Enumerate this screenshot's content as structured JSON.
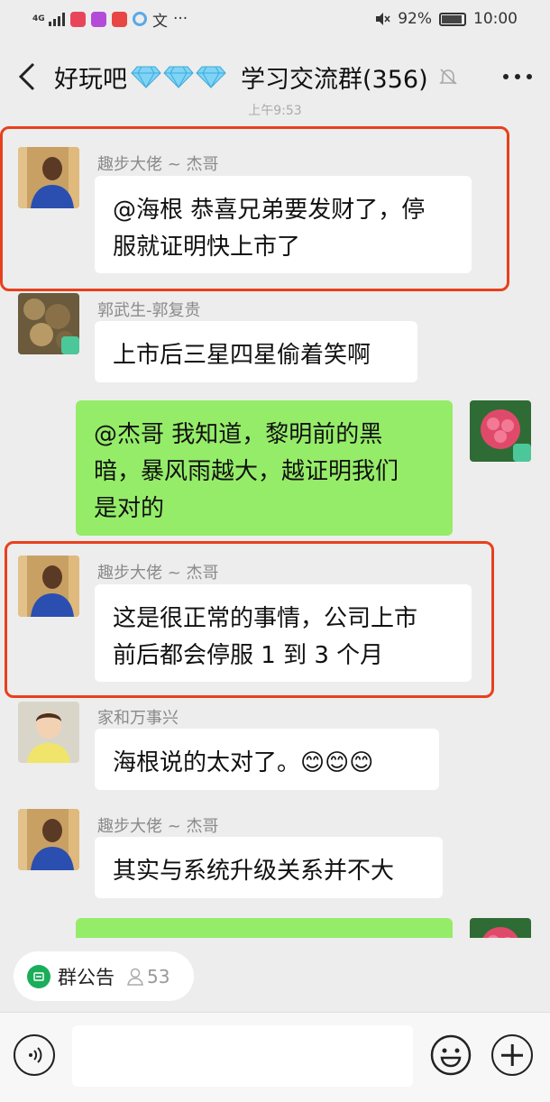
{
  "status_bar": {
    "network": "4G",
    "battery": "92%",
    "battery_level": 0.92,
    "time": "10:00",
    "extra_glyph": "文",
    "more": "···"
  },
  "header": {
    "title": "好玩吧",
    "title_suffix": "学习交流群(356)",
    "back_icon": "chevron-left-icon",
    "mute_icon": "bell-muted-icon",
    "more_icon": "more-dots-icon"
  },
  "timestamp": "上午9:53",
  "messages": [
    {
      "sender": "趣步大佬 ~ 杰哥",
      "text_lines": [
        "@海根  恭喜兄弟要发财了，停",
        "服就证明快上市了"
      ]
    },
    {
      "sender": "郭武生-郭复贵",
      "text_lines": [
        "上市后三星四星偷着笑啊"
      ]
    },
    {
      "sender": "",
      "text_lines": [
        "@杰哥  我知道，黎明前的黑",
        "暗，暴风雨越大，越证明我们",
        "是对的"
      ]
    },
    {
      "sender": "趣步大佬 ~ 杰哥",
      "text_lines": [
        "这是很正常的事情，公司上市",
        "前后都会停服 1 到 3 个月"
      ]
    },
    {
      "sender": "家和万事兴",
      "text_lines": [
        "海根说的太对了。😊😊😊"
      ]
    },
    {
      "sender": "趣步大佬 ~ 杰哥",
      "text_lines": [
        "其实与系统升级关系并不大"
      ]
    }
  ],
  "notice": {
    "label": "群公告",
    "member_count": "53"
  },
  "input": {
    "placeholder": ""
  },
  "colors": {
    "outgoing_bubble": "#95ec69",
    "highlight": "#e8401c",
    "background": "#ededed"
  }
}
